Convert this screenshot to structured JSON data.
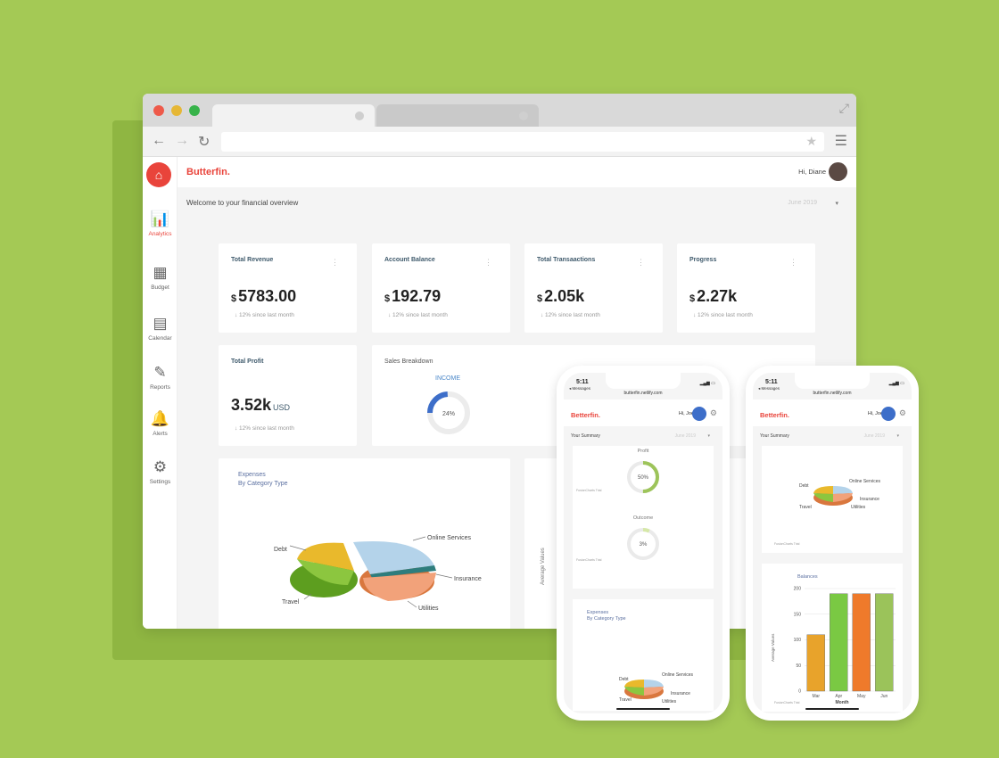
{
  "browser": {
    "sidebar": {
      "items": [
        {
          "label": "Analytics",
          "icon": "analytics-icon",
          "active": true
        },
        {
          "label": "Budget",
          "icon": "calculator-icon"
        },
        {
          "label": "Calendar",
          "icon": "calendar-icon"
        },
        {
          "label": "Reports",
          "icon": "reports-icon"
        },
        {
          "label": "Alerts",
          "icon": "bell-icon"
        },
        {
          "label": "Settings",
          "icon": "gear-icon"
        }
      ]
    },
    "header": {
      "brand": "Butterfin.",
      "greeting": "Hi, Diane"
    },
    "welcome": "Welcome to your financial overview",
    "period": "June 2019",
    "cards": [
      {
        "title": "Total Revenue",
        "currency": "$",
        "value": "5783.00",
        "sub": "↓ 12% since last month"
      },
      {
        "title": "Account Balance",
        "currency": "$",
        "value": "192.79",
        "sub": "↓ 12% since last month"
      },
      {
        "title": "Total Transaactions",
        "currency": "$",
        "value": "2.05k",
        "sub": "↓ 12% since last month"
      },
      {
        "title": "Progress",
        "currency": "$",
        "value": "2.27k",
        "sub": "↓ 12% since last month"
      }
    ],
    "profit": {
      "title": "Total Profit",
      "value": "3.52k",
      "unit": "USD",
      "sub": "↓ 12% since last month"
    },
    "sales": {
      "title": "Sales Breakdown",
      "income_label": "INCOME",
      "income_value": "24%",
      "outcome_partial": "utcom",
      "outcome_value": "3%"
    },
    "expenses": {
      "title_line1": "Expenses",
      "title_line2": "By Category Type",
      "labels": [
        "Debt",
        "Online Services",
        "Insurance",
        "Utilities",
        "Travel"
      ]
    },
    "avg_axis": "Average Values"
  },
  "phone1": {
    "time": "5:11",
    "back": "◂ Messages",
    "url": "butterfin.netlify.com",
    "brand": "Betterfin.",
    "greeting": "Hi, Joe",
    "summary": "Your Summary",
    "period": "June 2019",
    "profit_title": "Profit",
    "profit_value": "50%",
    "outcome_title": "Outcome",
    "outcome_value": "3%",
    "trial": "FusionCharts Trial",
    "expenses_line1": "Expenses",
    "expenses_line2": "By Category Type",
    "pie_labels": [
      "Debt",
      "Online Services",
      "Travel",
      "Insurance",
      "Utilities"
    ]
  },
  "phone2": {
    "time": "5:11",
    "back": "◂ Messages",
    "url": "butterfin.netlify.com",
    "brand": "Betterfin.",
    "greeting": "Hi, Joe",
    "summary": "Your Summary",
    "period": "June 2019",
    "trial": "FusionCharts Trial",
    "pie_labels": [
      "Debt",
      "Online Services",
      "Insurance",
      "Travel",
      "Utilities"
    ]
  },
  "chart_data": {
    "type": "bar",
    "title": "Balances",
    "xlabel": "Month",
    "ylabel": "Average Values",
    "categories": [
      "Mar",
      "Apr",
      "May",
      "Jun"
    ],
    "values": [
      110,
      190,
      190,
      190
    ],
    "ylim": [
      0,
      200
    ],
    "yticks": [
      0,
      50,
      100,
      150,
      200
    ],
    "colors": [
      "#e8a32b",
      "#7ac943",
      "#ef7a2b",
      "#9bc35a"
    ]
  }
}
